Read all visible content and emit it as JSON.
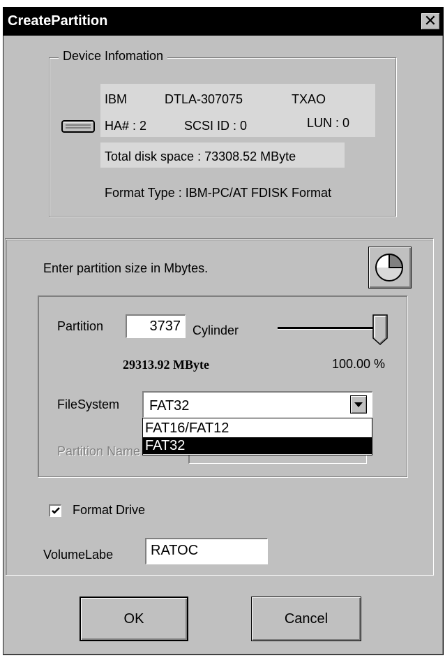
{
  "window": {
    "title": "CreatePartition",
    "close_glyph": "✕"
  },
  "device_info": {
    "legend": "Device Infomation",
    "vendor": "IBM",
    "model": "DTLA-307075",
    "revision": "TXAO",
    "ha": "HA# : 2",
    "scsi_id": "SCSI ID : 0",
    "lun": "LUN : 0",
    "total_space": "Total disk space : 73308.52  MByte",
    "format_type": "Format Type : IBM-PC/AT FDISK Format",
    "icon": "hard-disk-icon"
  },
  "partition_section": {
    "instruction": "Enter partition size in Mbytes.",
    "pie_icon": "pie-chart-icon",
    "partition_label": "Partition",
    "partition_value": "3737",
    "cylinder_label": "Cylinder",
    "slider_percent": 100,
    "size_text": "29313.92 MByte",
    "percent_text": "100.00 %",
    "filesystem_label": "FileSystem",
    "filesystem_value": "FAT32",
    "filesystem_options": [
      "FAT16/FAT12",
      "FAT32"
    ],
    "partition_name_label": "Partition Name",
    "format_drive_label": "Format Drive",
    "format_drive_checked": true,
    "volume_label_label": "VolumeLabe",
    "volume_label_value": "RATOC"
  },
  "buttons": {
    "ok": "OK",
    "cancel": "Cancel"
  },
  "colors": {
    "dialog_bg": "#c0c0c0",
    "title_bg": "#000000",
    "selection_bg": "#000000"
  }
}
